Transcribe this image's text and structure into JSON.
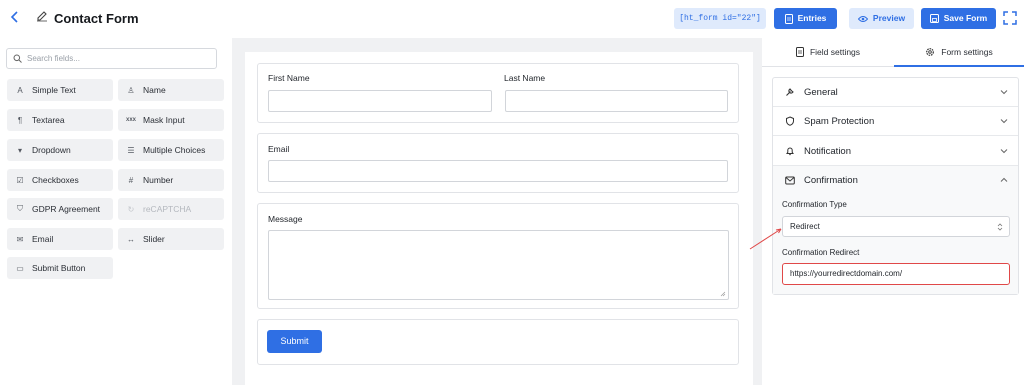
{
  "header": {
    "title": "Contact Form",
    "shortcode": "[ht_form id=\"22\"]",
    "entries_label": "Entries",
    "preview_label": "Preview",
    "save_label": "Save Form"
  },
  "sidebar": {
    "search_placeholder": "Search fields...",
    "fields": [
      {
        "label": "Simple Text",
        "icon": "text-icon",
        "glyph": "A"
      },
      {
        "label": "Name",
        "icon": "user-icon",
        "glyph": "♙"
      },
      {
        "label": "Textarea",
        "icon": "paragraph-icon",
        "glyph": "¶"
      },
      {
        "label": "Mask Input",
        "icon": "mask-icon",
        "glyph": "xxx"
      },
      {
        "label": "Dropdown",
        "icon": "dropdown-icon",
        "glyph": "▾"
      },
      {
        "label": "Multiple Choices",
        "icon": "list-icon",
        "glyph": "☰"
      },
      {
        "label": "Checkboxes",
        "icon": "checkbox-icon",
        "glyph": "☑"
      },
      {
        "label": "Number",
        "icon": "hash-icon",
        "glyph": "#"
      },
      {
        "label": "GDPR Agreement",
        "icon": "shield-icon",
        "glyph": "⛉"
      },
      {
        "label": "reCAPTCHA",
        "icon": "recaptcha-icon",
        "glyph": "↻"
      },
      {
        "label": "Email",
        "icon": "mail-icon",
        "glyph": "✉"
      },
      {
        "label": "Slider",
        "icon": "slider-icon",
        "glyph": "↔"
      },
      {
        "label": "Submit Button",
        "icon": "button-icon",
        "glyph": "▭"
      }
    ]
  },
  "form": {
    "first_name_label": "First Name",
    "last_name_label": "Last Name",
    "email_label": "Email",
    "message_label": "Message",
    "submit_label": "Submit"
  },
  "settings": {
    "tab_field": "Field settings",
    "tab_form": "Form settings",
    "sections": {
      "general": "General",
      "spam": "Spam Protection",
      "notification": "Notification",
      "confirmation": "Confirmation"
    },
    "confirmation_type_label": "Confirmation Type",
    "confirmation_type_value": "Redirect",
    "confirmation_redirect_label": "Confirmation Redirect",
    "confirmation_redirect_value": "https://yourredirectdomain.com/"
  },
  "colors": {
    "accent": "#2f6fe4",
    "accent_light": "#dfeafc",
    "highlight": "#e04848"
  }
}
